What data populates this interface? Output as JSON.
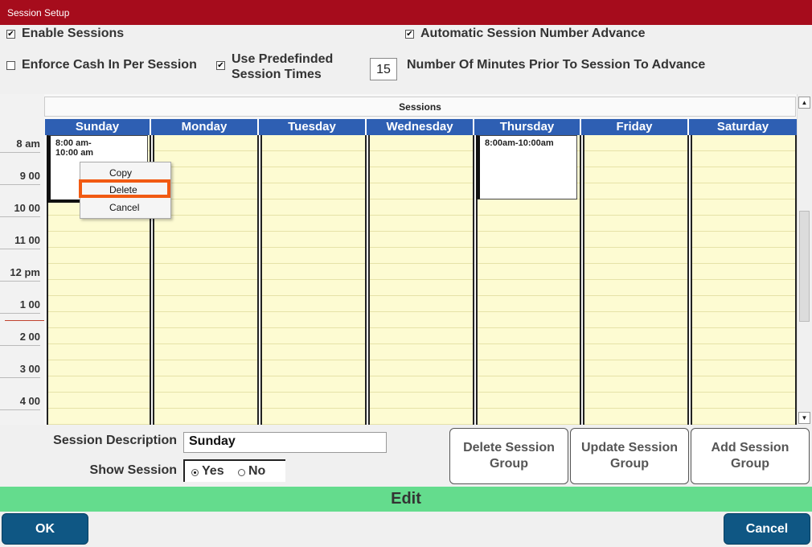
{
  "window": {
    "title": "Session Setup"
  },
  "options": {
    "enable_sessions": {
      "label": "Enable Sessions",
      "checked": true
    },
    "auto_advance": {
      "label": "Automatic Session Number Advance",
      "checked": true
    },
    "enforce_cash": {
      "label": "Enforce Cash In Per Session",
      "checked": false
    },
    "predefined_line1": "Use Predefinded",
    "predefined_line2": "Session Times",
    "predefined_checked": true,
    "minutes_value": "15",
    "minutes_label": "Number Of Minutes Prior To Session To Advance"
  },
  "calendar": {
    "title": "Sessions",
    "days": [
      "Sunday",
      "Monday",
      "Tuesday",
      "Wednesday",
      "Thursday",
      "Friday",
      "Saturday"
    ],
    "times": [
      "8 am",
      "9 00",
      "10 00",
      "11 00",
      "12 pm",
      "1 00",
      "2 00",
      "3 00",
      "4 00"
    ],
    "appointments": {
      "sunday_line1": "8:00 am-",
      "sunday_line2": "10:00 am",
      "thursday": "8:00am-10:00am"
    }
  },
  "context_menu": {
    "items": [
      "Copy",
      "Delete",
      "Cancel"
    ],
    "highlighted": "Delete"
  },
  "form": {
    "description_label": "Session Description",
    "description_value": "Sunday",
    "show_label": "Show Session",
    "yes_label": "Yes",
    "no_label": "No",
    "selected": "Yes"
  },
  "buttons": {
    "delete_group_l1": "Delete Session",
    "delete_group_l2": "Group",
    "update_group_l1": "Update Session",
    "update_group_l2": "Group",
    "add_group_l1": "Add Session",
    "add_group_l2": "Group",
    "ok": "OK",
    "cancel": "Cancel"
  },
  "status_bar": {
    "label": "Edit"
  },
  "icons": {
    "checkmark": "✔",
    "scroll_up": "▲",
    "scroll_down": "▼"
  },
  "colors": {
    "title_bar": "#a60c1c",
    "day_header": "#2e5fb3",
    "edit_bar": "#64dc8d",
    "footer_button": "#0f5784",
    "highlight": "#f15a12"
  }
}
